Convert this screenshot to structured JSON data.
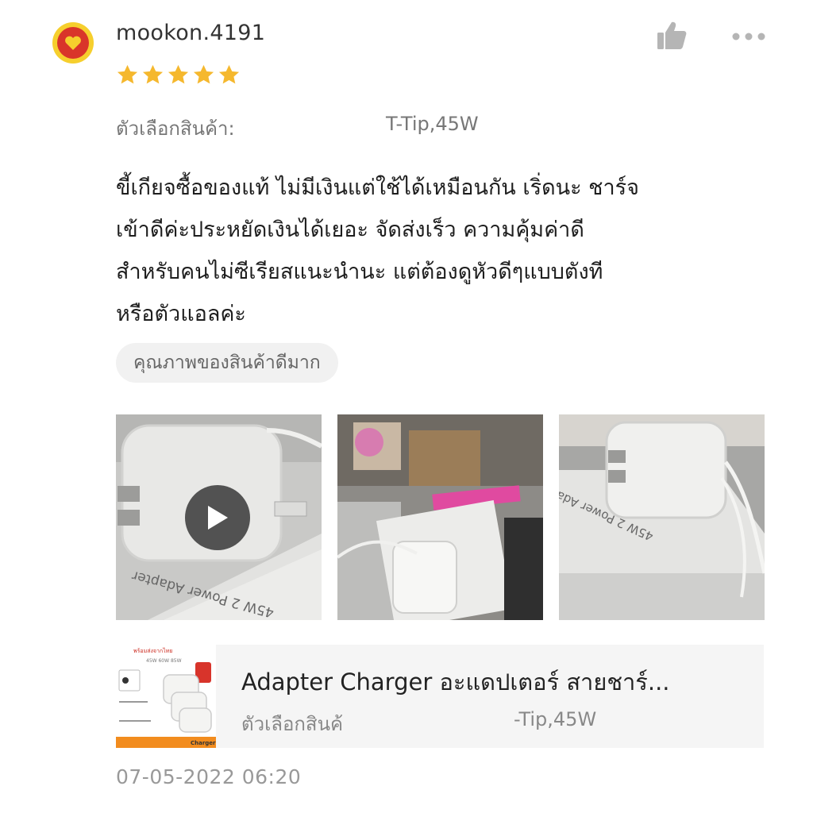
{
  "review": {
    "username": "mookon.4191",
    "rating": 5,
    "variant_label": "ตัวเลือกสินค้า:",
    "variant_value": "T-Tip,45W",
    "lines": [
      "ขี้เกียจซื้อของแท้ ไม่มีเงินแต่ใช้ได้เหมือนกัน เริ่ดนะ ชาร์จ",
      "เข้าดีค่ะประหยัดเงินได้เยอะ จัดส่งเร็ว ความคุ้มค่าดี",
      "สำหรับคนไม่ซีเรียสแนะนำนะ แต่ต้องดูหัวดีๆแบบตังที",
      "หรือตัวแอลค่ะ"
    ],
    "tag": "คุณภาพของสินค้าดีมาก",
    "photos": [
      {
        "name": "photo-video-adapter",
        "has_video": true,
        "box_text": "45W 2 Power Adapter"
      },
      {
        "name": "photo-adapter-desk",
        "has_video": false
      },
      {
        "name": "photo-adapter-box",
        "has_video": false,
        "box_text": "45W 2 Power Adapter"
      }
    ],
    "timestamp": "07-05-2022 06:20"
  },
  "product": {
    "title": "Adapter Charger อะแดปเตอร์ สายชาร์...",
    "variant_label": "ตัวเลือกสินค้",
    "variant_value": "-Tip,45W",
    "thumb_header": "พร้อมส่งจากไทย",
    "thumb_watts": "45W 60W 85W",
    "thumb_footer": "Charger"
  },
  "colors": {
    "star": "#f5b82e",
    "icon_gray": "#b5b5b5",
    "avatar_ring": "#f6cf2d",
    "avatar_center": "#d9352a",
    "thumb_orange": "#f28c1e"
  },
  "icons": {
    "like": "thumbs-up-icon",
    "more": "more-dots-icon",
    "play": "play-icon",
    "star": "star-icon"
  }
}
